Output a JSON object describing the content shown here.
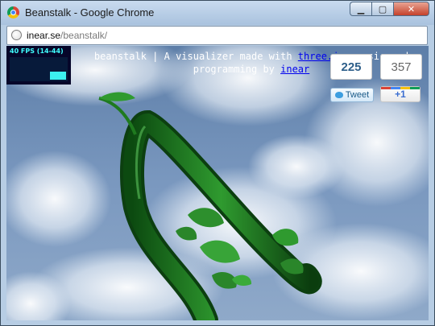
{
  "window": {
    "title": "Beanstalk - Google Chrome",
    "min": "▁",
    "max": "▢",
    "close": "✕"
  },
  "address": {
    "host": "inear.se",
    "path": "/beanstalk/"
  },
  "stats": {
    "fps": "40 FPS (14-44)"
  },
  "header": {
    "pre": "beanstalk | A visualizer made with ",
    "link1": "three.js",
    "mid": ", music and programming by ",
    "link2": "inear"
  },
  "social": {
    "tweet_count": "225",
    "tweet_label": "Tweet",
    "plus_count": "357",
    "plus_label": "+1"
  },
  "colors": {
    "sky": "#6f90b8",
    "vine": "#1e7a1e",
    "fps_text": "#40ffff"
  }
}
